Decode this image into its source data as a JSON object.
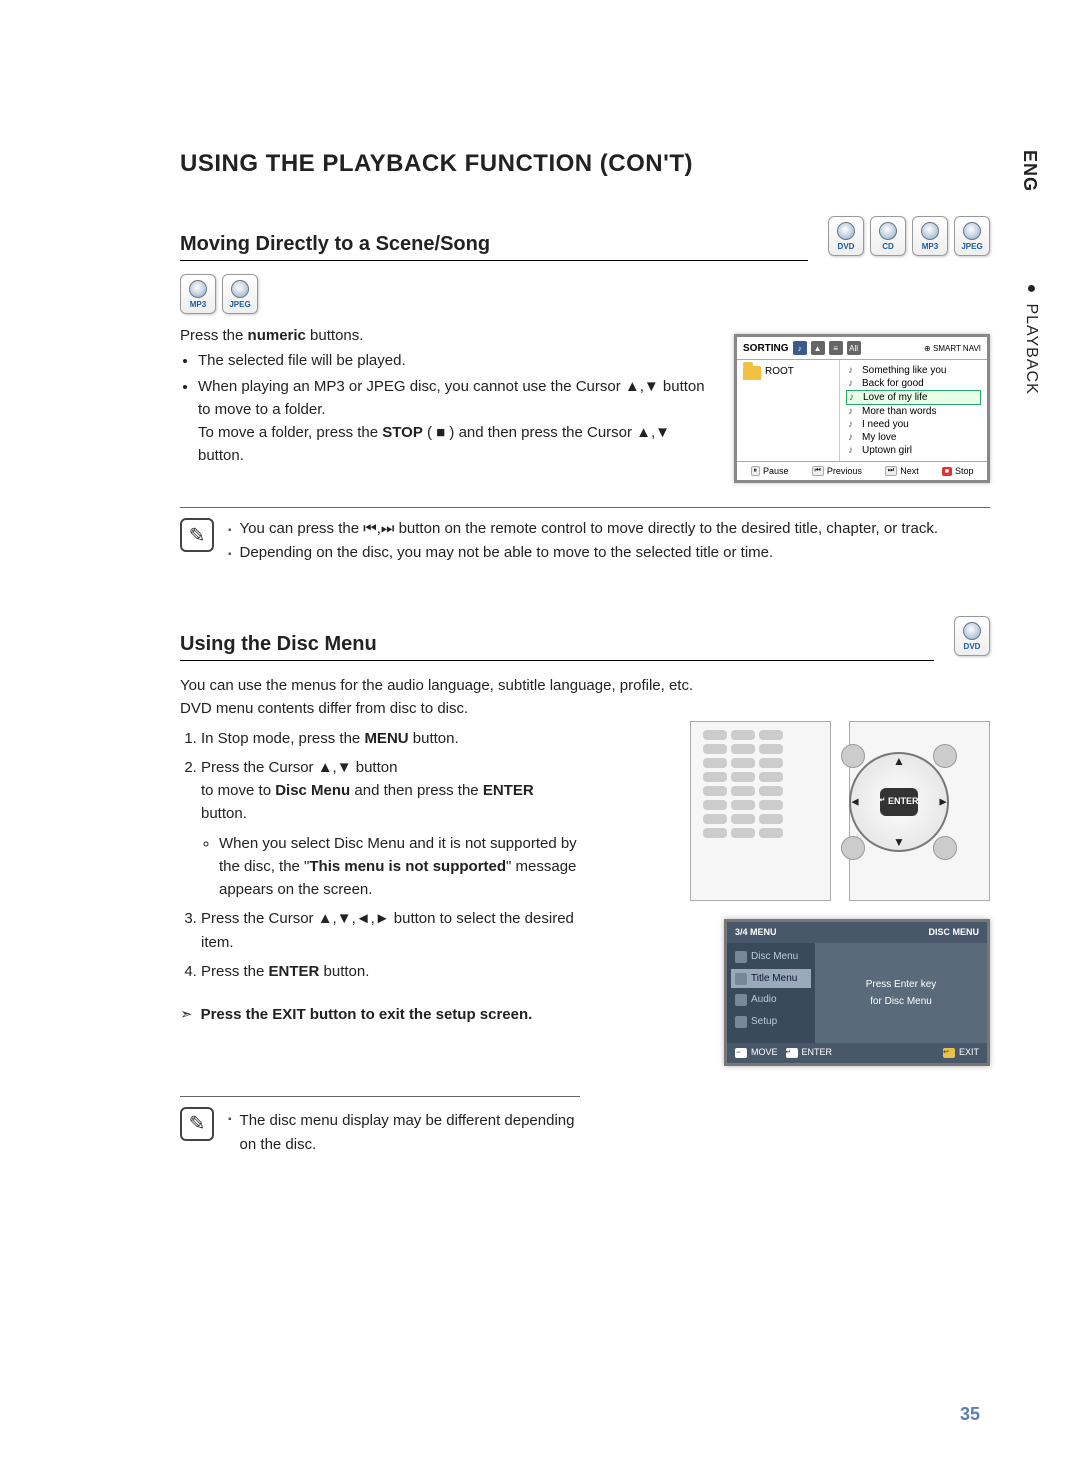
{
  "lang_tab": "ENG",
  "section_tab": "PLAYBACK",
  "page_number": "35",
  "title": "USING THE PLAYBACK FUNCTION (CON'T)",
  "badges": {
    "dvd": "DVD",
    "cd": "CD",
    "mp3": "MP3",
    "jpeg": "JPEG"
  },
  "s1": {
    "heading": "Moving Directly to a Scene/Song",
    "intro_prefix": "Press the ",
    "intro_bold": "numeric",
    "intro_suffix": " buttons.",
    "b1": "The selected file will be played.",
    "b2": "When playing an MP3 or JPEG disc, you cannot use the Cursor ▲,▼ button to move to a folder.",
    "b2_line2_prefix": "To move a folder, press the ",
    "b2_line2_bold": "STOP",
    "b2_line2_suffix": " ( ■ ) and then press the Cursor ▲,▼ button.",
    "note1": "You can press the ⏮,⏭ button on the remote control to move directly to the desired title, chapter, or track.",
    "note2": "Depending on the disc, you may not be able to move to the selected title or time.",
    "panel": {
      "sorting": "SORTING",
      "smart": "SMART NAVI",
      "root": "ROOT",
      "songs": [
        "Something like you",
        "Back for good",
        "Love of my life",
        "More than words",
        "I need you",
        "My love",
        "Uptown girl"
      ],
      "pause": "Pause",
      "previous": "Previous",
      "next": "Next",
      "stop": "Stop"
    }
  },
  "s2": {
    "heading": "Using the Disc Menu",
    "p1": "You can use the menus for the audio language, subtitle language, profile, etc.",
    "p2": "DVD menu contents differ from disc to disc.",
    "li1_prefix": "In Stop mode, press the ",
    "li1_bold": "MENU",
    "li1_suffix": " button.",
    "li2_line1": "Press the Cursor ▲,▼ button",
    "li2_line2_prefix": "to move to ",
    "li2_line2_bold": "Disc Menu",
    "li2_line2_mid": " and then press the ",
    "li2_line2_bold2": "ENTER",
    "li2_line2_suffix": " button.",
    "li2_sub_prefix": "When you select Disc Menu and it is not supported by the disc, the \"",
    "li2_sub_bold": "This menu is not supported",
    "li2_sub_suffix": "\" message appears on the screen.",
    "li3": "Press the Cursor ▲,▼,◄,► button to select the desired item.",
    "li4_prefix": "Press the ",
    "li4_bold": "ENTER",
    "li4_suffix": " button.",
    "exit": "Press the EXIT button to exit the setup screen.",
    "note": "The disc menu display may be different depending on the disc.",
    "enter_label": "ENTER",
    "osd": {
      "title_left": "3/4 MENU",
      "title_right": "DISC MENU",
      "items": [
        "Disc Menu",
        "Title Menu",
        "Audio",
        "Setup"
      ],
      "msg1": "Press Enter key",
      "msg2": "for Disc Menu",
      "move": "MOVE",
      "enter": "ENTER",
      "exit": "EXIT"
    }
  }
}
